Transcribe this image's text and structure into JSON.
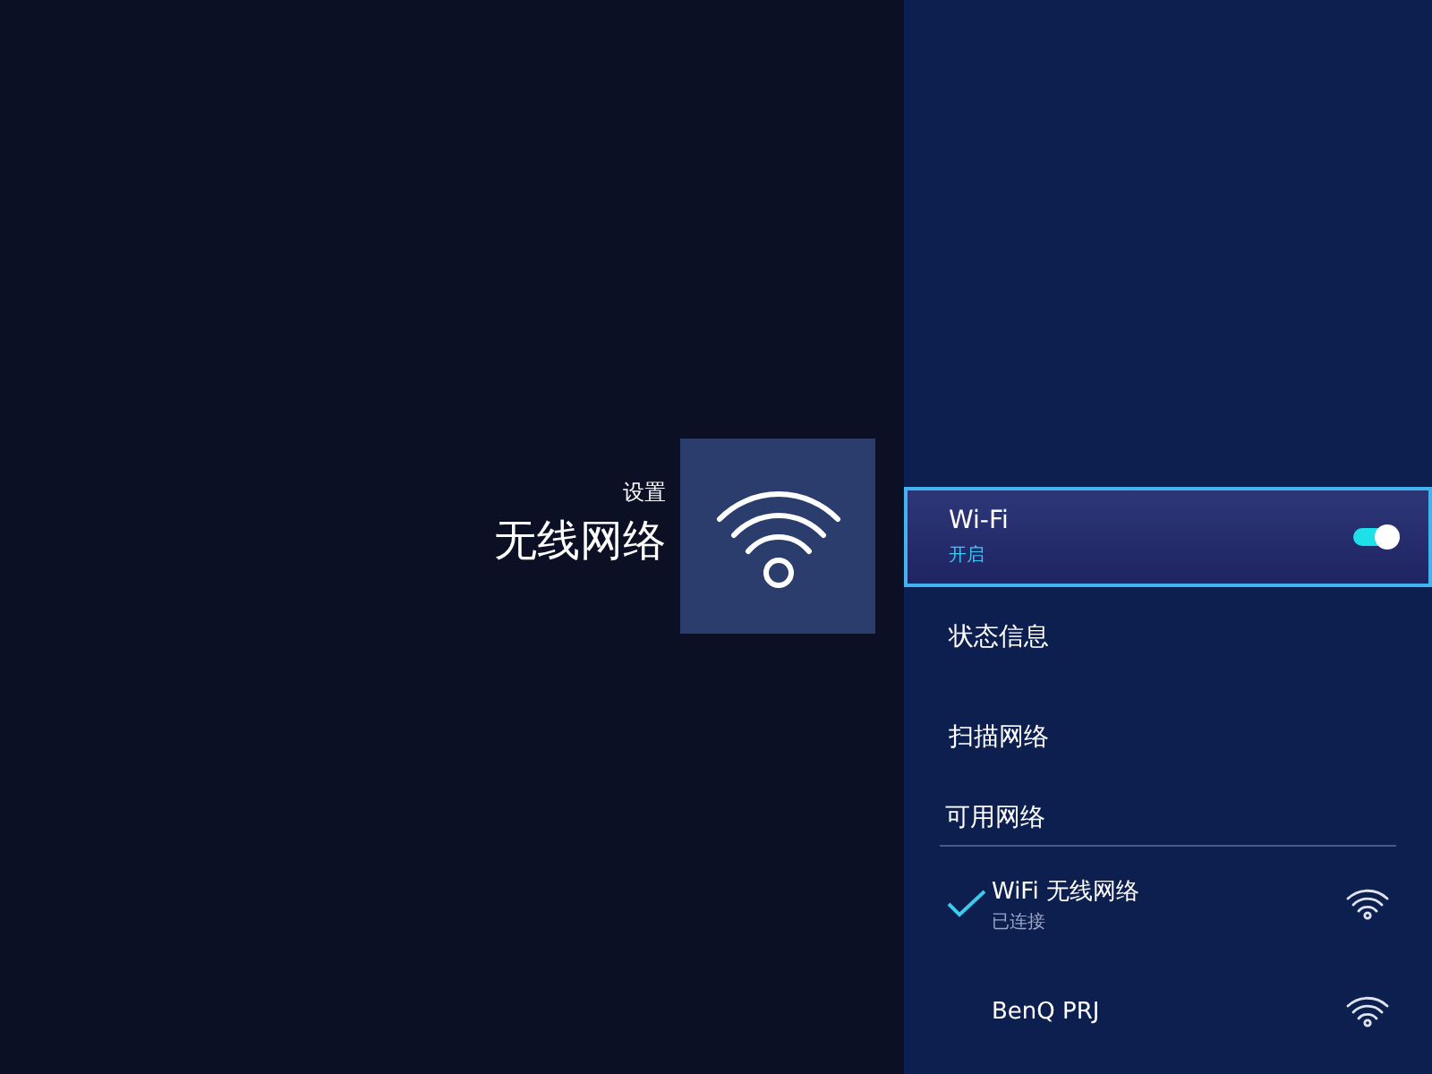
{
  "header": {
    "breadcrumb": "设置",
    "title": "无线网络"
  },
  "menu": [
    {
      "kind": "toggle",
      "label": "Wi-Fi",
      "value": "开启",
      "on": true,
      "selected": true
    },
    {
      "kind": "link",
      "label": "状态信息",
      "selected": false
    },
    {
      "kind": "link",
      "label": "扫描网络",
      "selected": false
    }
  ],
  "networks_heading": "可用网络",
  "networks": [
    {
      "name": "WiFi 无线网络",
      "status": "已连接",
      "connected": true
    },
    {
      "name": "BenQ PRJ",
      "connected": false
    }
  ]
}
